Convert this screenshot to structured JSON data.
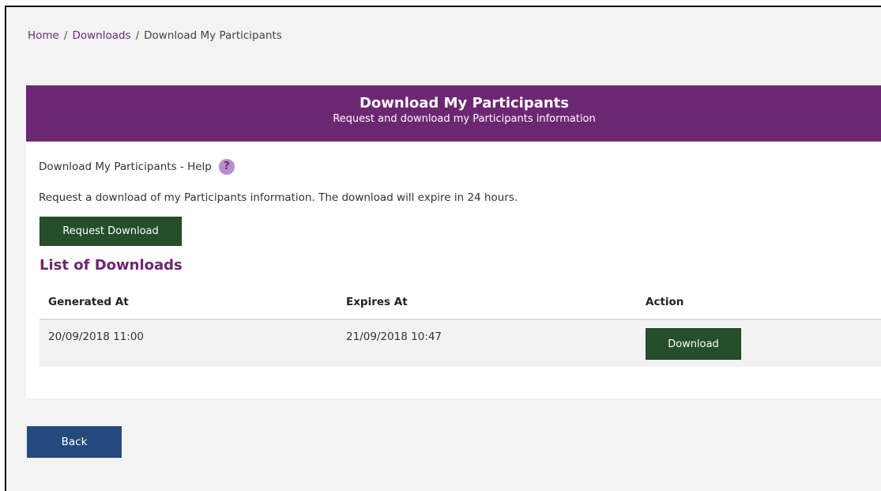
{
  "breadcrumb": {
    "home": "Home",
    "separator": "/",
    "downloads": "Downloads",
    "current": "Download My Participants"
  },
  "header": {
    "title": "Download My Participants",
    "subtitle": "Request and download my Participants information"
  },
  "help": {
    "label": "Download My Participants - Help",
    "icon": "question-icon",
    "icon_glyph": "?"
  },
  "info_text": "Request a download of my Participants information. The download will expire in 24 hours.",
  "request_button_label": "Request Download",
  "list_title": "List of Downloads",
  "table": {
    "headers": [
      "Generated At",
      "Expires At",
      "Action"
    ],
    "rows": [
      {
        "generated_at": "20/09/2018 11:00",
        "expires_at": "21/09/2018 10:47",
        "action_label": "Download"
      }
    ]
  },
  "back_button_label": "Back",
  "colors": {
    "header_purple": "#6c2773",
    "button_green": "#254f2a",
    "button_blue": "#244a7d",
    "link_purple": "#6b2a7a",
    "help_icon": "#b98dcc"
  }
}
